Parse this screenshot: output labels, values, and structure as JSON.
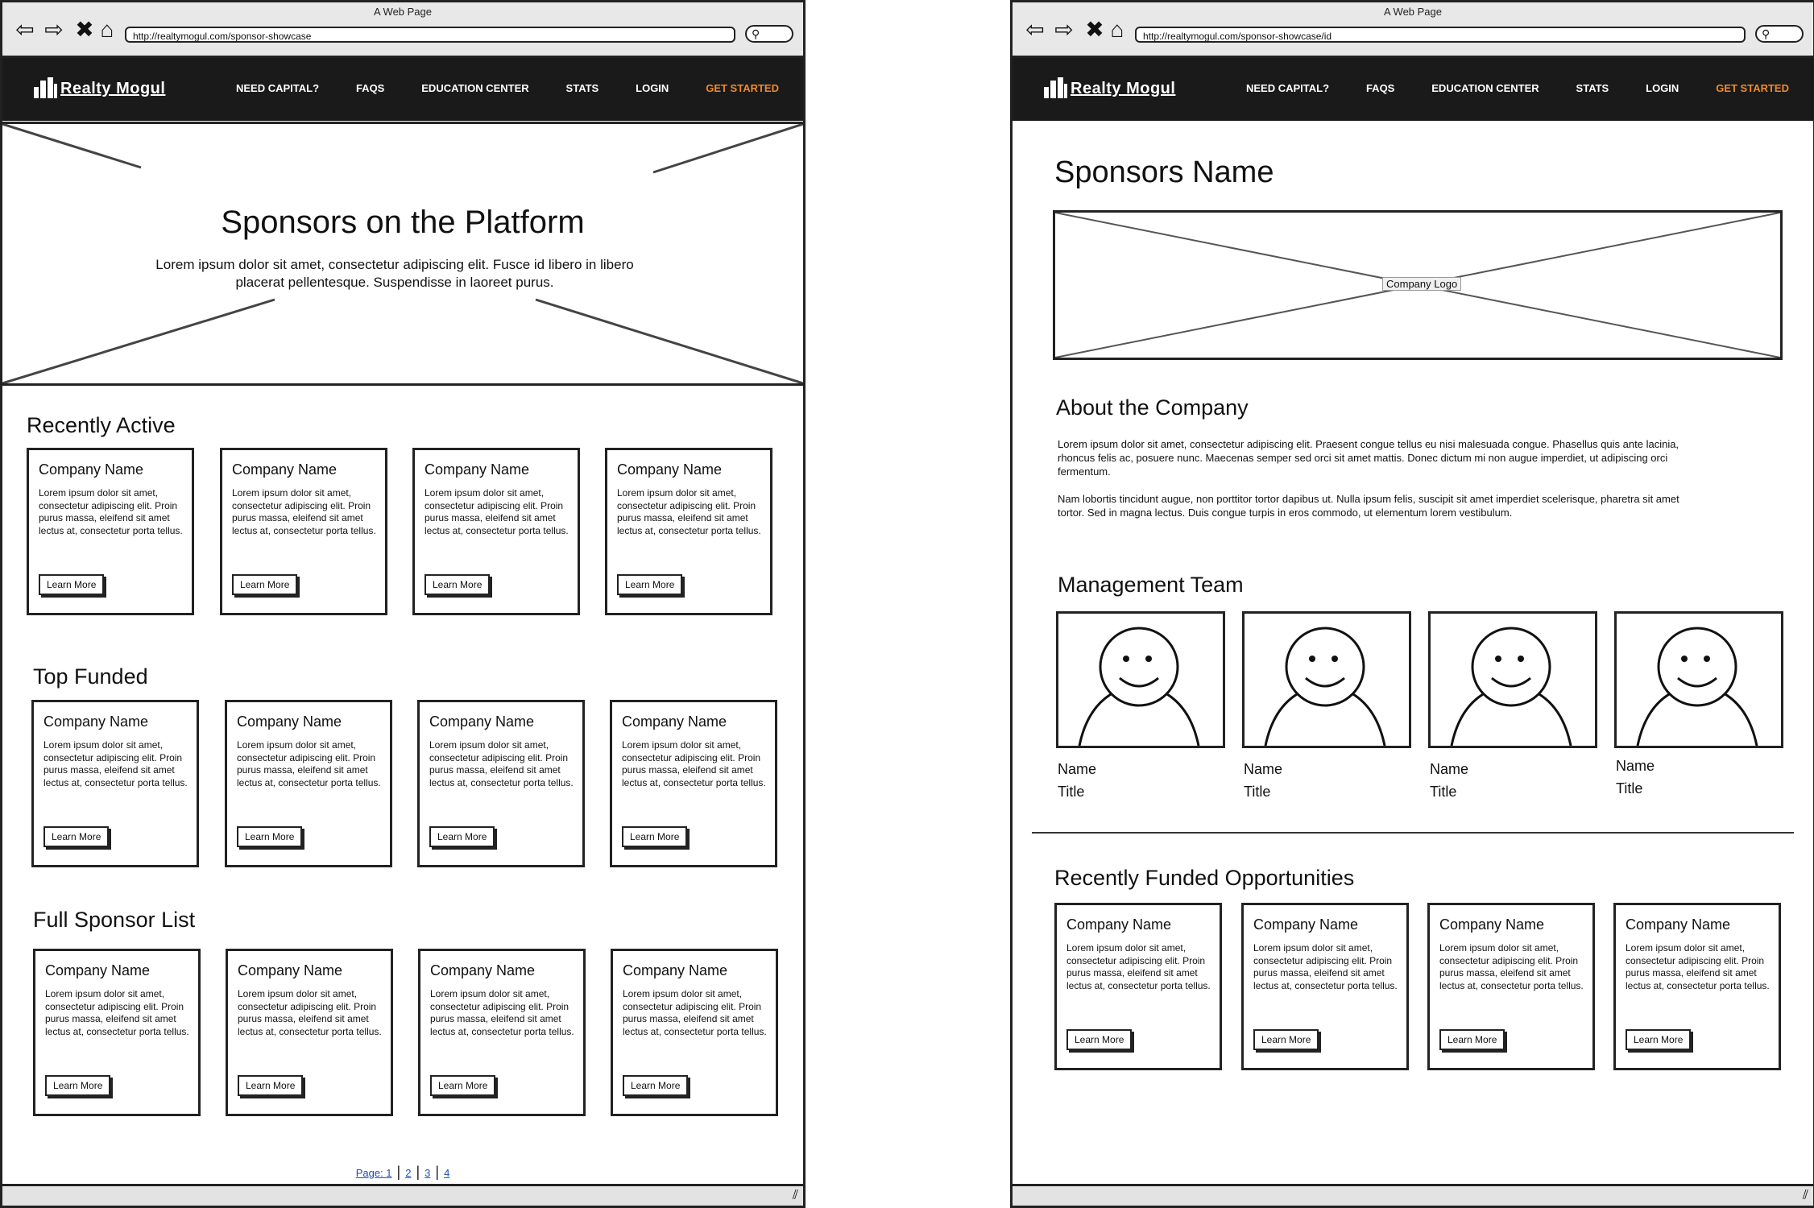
{
  "left": {
    "window_title": "A Web Page",
    "url": "http://realtymogul.com/sponsor-showcase",
    "logo_text": "Realty Mogul",
    "nav": [
      "NEED CAPITAL?",
      "FAQS",
      "EDUCATION CENTER",
      "STATS",
      "LOGIN",
      "GET STARTED"
    ],
    "hero_title": "Sponsors on the Platform",
    "hero_text": "Lorem ipsum dolor sit amet, consectetur adipiscing elit. Fusce id libero in libero placerat pellentesque. Suspendisse in laoreet purus.",
    "sections": [
      {
        "title": "Recently Active",
        "cards": [
          {
            "name": "Company Name",
            "text": "Lorem ipsum dolor sit amet, consectetur adipiscing elit. Proin purus massa, eleifend sit amet lectus at, consectetur porta tellus.",
            "button": "Learn More"
          },
          {
            "name": "Company Name",
            "text": "Lorem ipsum dolor sit amet, consectetur adipiscing elit. Proin purus massa, eleifend sit amet lectus at, consectetur porta tellus.",
            "button": "Learn More"
          },
          {
            "name": "Company Name",
            "text": "Lorem ipsum dolor sit amet, consectetur adipiscing elit. Proin purus massa, eleifend sit amet lectus at, consectetur porta tellus.",
            "button": "Learn More"
          },
          {
            "name": "Company Name",
            "text": "Lorem ipsum dolor sit amet, consectetur adipiscing elit. Proin purus massa, eleifend sit amet lectus at, consectetur porta tellus.",
            "button": "Learn More"
          }
        ]
      },
      {
        "title": "Top Funded",
        "cards": [
          {
            "name": "Company Name",
            "text": "Lorem ipsum dolor sit amet, consectetur adipiscing elit. Proin purus massa, eleifend sit amet lectus at, consectetur porta tellus.",
            "button": "Learn More"
          },
          {
            "name": "Company Name",
            "text": "Lorem ipsum dolor sit amet, consectetur adipiscing elit. Proin purus massa, eleifend sit amet lectus at, consectetur porta tellus.",
            "button": "Learn More"
          },
          {
            "name": "Company Name",
            "text": "Lorem ipsum dolor sit amet, consectetur adipiscing elit. Proin purus massa, eleifend sit amet lectus at, consectetur porta tellus.",
            "button": "Learn More"
          },
          {
            "name": "Company Name",
            "text": "Lorem ipsum dolor sit amet, consectetur adipiscing elit. Proin purus massa, eleifend sit amet lectus at, consectetur porta tellus.",
            "button": "Learn More"
          }
        ]
      },
      {
        "title": "Full Sponsor List",
        "cards": [
          {
            "name": "Company Name",
            "text": "Lorem ipsum dolor sit amet, consectetur adipiscing elit. Proin purus massa, eleifend sit amet lectus at, consectetur porta tellus.",
            "button": "Learn More"
          },
          {
            "name": "Company Name",
            "text": "Lorem ipsum dolor sit amet, consectetur adipiscing elit. Proin purus massa, eleifend sit amet lectus at, consectetur porta tellus.",
            "button": "Learn More"
          },
          {
            "name": "Company Name",
            "text": "Lorem ipsum dolor sit amet, consectetur adipiscing elit. Proin purus massa, eleifend sit amet lectus at, consectetur porta tellus.",
            "button": "Learn More"
          },
          {
            "name": "Company Name",
            "text": "Lorem ipsum dolor sit amet, consectetur adipiscing elit. Proin purus massa, eleifend sit amet lectus at, consectetur porta tellus.",
            "button": "Learn More"
          }
        ]
      }
    ],
    "pagination": [
      "Page: 1",
      "2",
      "3",
      "4"
    ]
  },
  "right": {
    "window_title": "A Web Page",
    "url": "http://realtymogul.com/sponsor-showcase/id",
    "logo_text": "Realty Mogul",
    "nav": [
      "NEED CAPITAL?",
      "FAQS",
      "EDUCATION CENTER",
      "STATS",
      "LOGIN",
      "GET STARTED"
    ],
    "sponsor_name": "Sponsors Name",
    "logo_placeholder": "Company Logo",
    "about_title": "About the Company",
    "about_paragraphs": [
      "Lorem ipsum dolor sit amet, consectetur adipiscing elit. Praesent congue tellus eu nisi malesuada congue. Phasellus quis ante lacinia, rhoncus felis ac, posuere nunc. Maecenas semper sed orci sit amet mattis. Donec dictum mi non augue imperdiet, ut adipiscing orci fermentum.",
      "Nam lobortis tincidunt augue, non porttitor tortor dapibus ut. Nulla ipsum felis, suscipit sit amet imperdiet scelerisque, pharetra sit amet tortor. Sed in magna lectus. Duis congue turpis in eros commodo, ut elementum lorem vestibulum."
    ],
    "team_title": "Management Team",
    "team": [
      {
        "name": "Name",
        "title": "Title"
      },
      {
        "name": "Name",
        "title": "Title"
      },
      {
        "name": "Name",
        "title": "Title"
      },
      {
        "name": "Name",
        "title": "Title"
      }
    ],
    "funded_title": "Recently Funded Opportunities",
    "funded_cards": [
      {
        "name": "Company Name",
        "text": "Lorem ipsum dolor sit amet, consectetur adipiscing elit. Proin purus massa, eleifend sit amet lectus at, consectetur porta tellus.",
        "button": "Learn More"
      },
      {
        "name": "Company Name",
        "text": "Lorem ipsum dolor sit amet, consectetur adipiscing elit. Proin purus massa, eleifend sit amet lectus at, consectetur porta tellus.",
        "button": "Learn More"
      },
      {
        "name": "Company Name",
        "text": "Lorem ipsum dolor sit amet, consectetur adipiscing elit. Proin purus massa, eleifend sit amet lectus at, consectetur porta tellus.",
        "button": "Learn More"
      },
      {
        "name": "Company Name",
        "text": "Lorem ipsum dolor sit amet, consectetur adipiscing elit. Proin purus massa, eleifend sit amet lectus at, consectetur porta tellus.",
        "button": "Learn More"
      }
    ]
  },
  "colors": {
    "nav_bg": "#1a1a1a",
    "accent": "#f08a2c",
    "link": "#1a4fb3"
  }
}
